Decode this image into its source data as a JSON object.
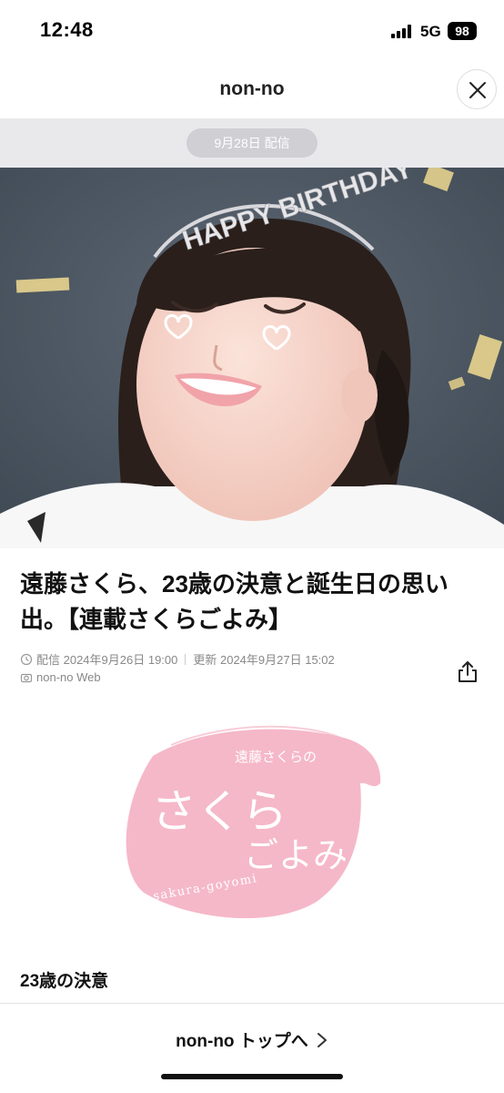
{
  "status_bar": {
    "time": "12:48",
    "network": "5G",
    "battery": "98"
  },
  "header": {
    "title": "non-no",
    "close_icon": "close-icon"
  },
  "delivery": {
    "label": "9月28日 配信"
  },
  "hero": {
    "image_label": "HAPPY BIRTHDAY",
    "background_color": "#4d5966"
  },
  "article": {
    "title": "遠藤さくら、23歳の決意と誕生日の思い出。【連載さくらごよみ】",
    "published": "配信 2024年9月26日 19:00",
    "updated": "更新 2024年9月27日 15:02",
    "source": "non-no Web",
    "share_icon": "share-icon"
  },
  "logo": {
    "subtitle": "遠藤さくらの",
    "main_top": "さくら",
    "main_bottom": "ごよみ",
    "romaji": "sakura-goyomi",
    "color": "#f5b8c8"
  },
  "section": {
    "heading": "23歳の決意"
  },
  "bottom_nav": {
    "link_label": "non-no トップへ"
  }
}
